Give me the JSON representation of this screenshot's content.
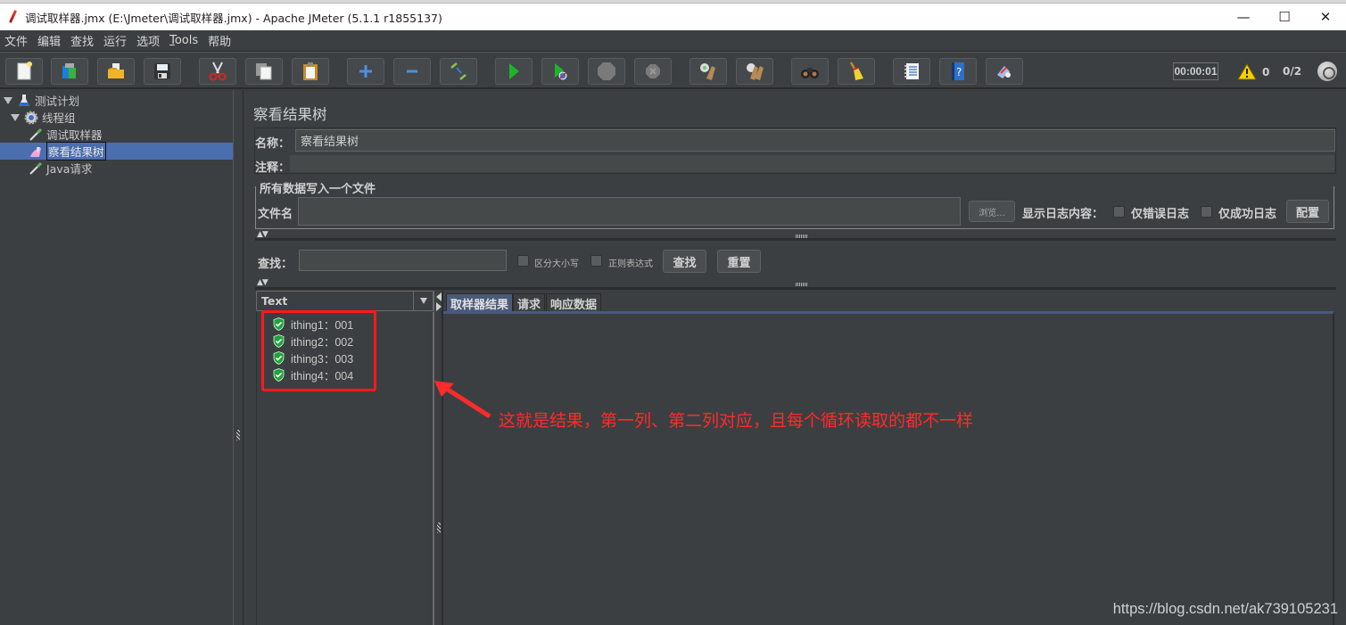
{
  "window": {
    "title": "调试取样器.jmx (E:\\Jmeter\\调试取样器.jmx) - Apache JMeter (5.1.1 r1855137)",
    "controls": {
      "minimize": "—",
      "maximize": "☐",
      "close": "✕"
    }
  },
  "menu": [
    "文件",
    "编辑",
    "查找",
    "运行",
    "选项",
    "Tools",
    "帮助"
  ],
  "toolbar": {
    "buttons": [
      {
        "name": "new-icon",
        "tooltip": "new"
      },
      {
        "name": "templates-icon",
        "tooltip": "templates"
      },
      {
        "name": "open-icon",
        "tooltip": "open"
      },
      {
        "name": "save-icon",
        "tooltip": "save"
      },
      {
        "name": "cut-icon",
        "tooltip": "cut"
      },
      {
        "name": "copy-icon",
        "tooltip": "copy"
      },
      {
        "name": "paste-icon",
        "tooltip": "paste"
      },
      {
        "name": "expand-icon",
        "tooltip": "expand all"
      },
      {
        "name": "collapse-icon",
        "tooltip": "collapse all"
      },
      {
        "name": "toggle-icon",
        "tooltip": "toggle"
      },
      {
        "name": "start-icon",
        "tooltip": "start"
      },
      {
        "name": "start-no-pause-icon",
        "tooltip": "start no pauses"
      },
      {
        "name": "stop-icon",
        "tooltip": "stop"
      },
      {
        "name": "shutdown-icon",
        "tooltip": "shutdown"
      },
      {
        "name": "clear-icon",
        "tooltip": "clear"
      },
      {
        "name": "clear-all-icon",
        "tooltip": "clear all"
      },
      {
        "name": "search-icon",
        "tooltip": "search"
      },
      {
        "name": "reset-search-icon",
        "tooltip": "reset search"
      },
      {
        "name": "function-helper-icon",
        "tooltip": "function helper"
      },
      {
        "name": "help-icon",
        "tooltip": "help"
      },
      {
        "name": "remote-icon",
        "tooltip": "remote"
      }
    ],
    "timer": "00:00:01",
    "warnings": "0",
    "threads": "0/2"
  },
  "tree": [
    {
      "label": "测试计划",
      "level": 0,
      "icon": "flask-icon",
      "expanded": true
    },
    {
      "label": "线程组",
      "level": 1,
      "icon": "gear-icon",
      "expanded": true
    },
    {
      "label": "调试取样器",
      "level": 2,
      "icon": "pipette-icon"
    },
    {
      "label": "察看结果树",
      "level": 2,
      "icon": "listener-icon",
      "selected": true
    },
    {
      "label": "Java请求",
      "level": 2,
      "icon": "pipette-icon"
    }
  ],
  "panel": {
    "title": "察看结果树",
    "name_label": "名称：",
    "name_value": "察看结果树",
    "comment_label": "注释：",
    "comment_value": "",
    "file_group_legend": "所有数据写入一个文件",
    "filename_label": "文件名",
    "filename_value": "",
    "browse_button": "浏览...",
    "log_content_label": "显示日志内容：",
    "errors_only_label": "仅错误日志",
    "success_only_label": "仅成功日志",
    "configure_button": "配置",
    "search_label": "查找：",
    "search_value": "",
    "case_sensitive_label": "区分大小写",
    "regex_label": "正则表达式",
    "search_button": "查找",
    "reset_button": "重置",
    "renderer_selected": "Text",
    "results": [
      {
        "label": "ithing1：001",
        "status": "success"
      },
      {
        "label": "ithing2：002",
        "status": "success"
      },
      {
        "label": "ithing3：003",
        "status": "success"
      },
      {
        "label": "ithing4：004",
        "status": "success"
      }
    ],
    "tabs": [
      "取样器结果",
      "请求",
      "响应数据"
    ],
    "active_tab": "取样器结果"
  },
  "annotation": "这就是结果，第一列、第二列对应，且每个循环读取的都不一样",
  "watermark": "https://blog.csdn.net/ak739105231",
  "colors": {
    "background": "#3c3f41",
    "selection": "#4b6eaf",
    "annotation_red": "#ff1a1a",
    "success_green": "#1fa33a"
  }
}
